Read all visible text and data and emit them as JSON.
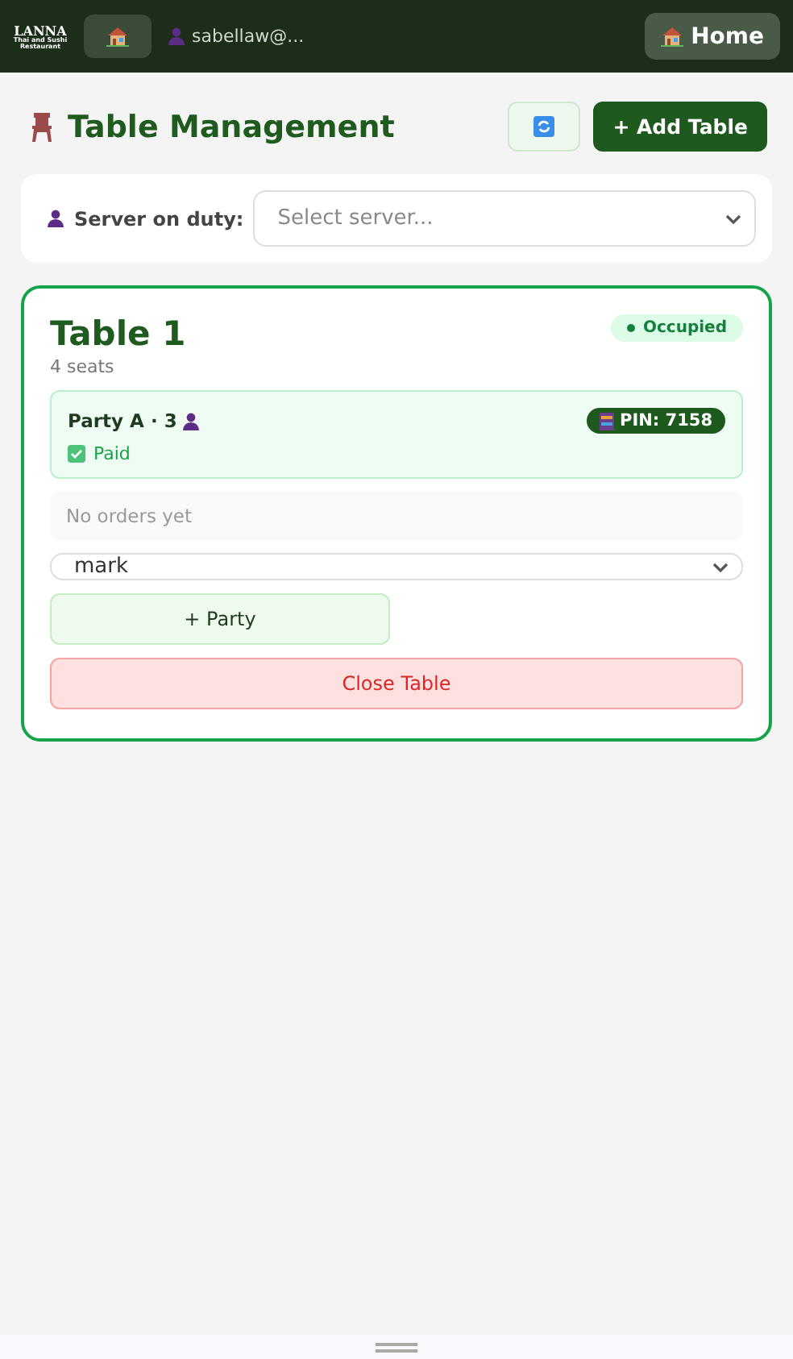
{
  "header": {
    "logo": {
      "name": "LANNA",
      "tagline": "Thai and Sushi",
      "subtitle": "Restaurant"
    },
    "user": "sabellaw@...",
    "home_button": "Home"
  },
  "page": {
    "title": "Table Management",
    "add_button": "+ Add Table"
  },
  "server": {
    "label": "Server on duty:",
    "placeholder": "Select server..."
  },
  "tables": [
    {
      "name": "Table 1",
      "seats": "4 seats",
      "status": "Occupied",
      "kind": "occupied",
      "parties": [
        {
          "name": "Party A · 3",
          "pin": "PIN: 7158",
          "paid": true,
          "paid_label": "Paid"
        }
      ],
      "orders_text": "No orders yet",
      "server_value": "mark",
      "add_party": "+ Party",
      "close_button": "Close Table"
    }
  ]
}
